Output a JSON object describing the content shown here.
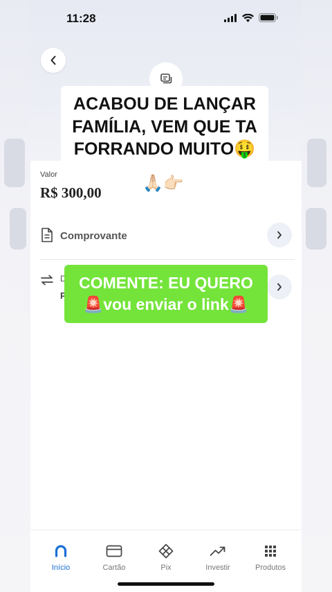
{
  "status_bar": {
    "time": "11:28"
  },
  "header": {
    "back_icon": "chevron-left-icon",
    "receipt_icon": "receipt-icon"
  },
  "overlay_top": {
    "line1": "ACABOU DE LANÇAR",
    "line2": "FAMÍLIA, VEM QUE TA",
    "line3": "FORRANDO MUITO🤑"
  },
  "transaction": {
    "valor_label": "Valor",
    "valor_amount": "R$ 300,00",
    "emoji": "🙏🏻👉🏻"
  },
  "rows": {
    "comprovante_label": "Comprovante",
    "partial_label": "D",
    "partial_bold": "P"
  },
  "overlay_bottom": {
    "line1": "COMENTE: EU QUERO",
    "line2": "🚨vou enviar o link🚨"
  },
  "tabbar": {
    "items": [
      {
        "label": "Início",
        "icon": "home-icon",
        "active": true
      },
      {
        "label": "Cartão",
        "icon": "card-icon"
      },
      {
        "label": "Pix",
        "icon": "pix-icon"
      },
      {
        "label": "Investir",
        "icon": "trend-up-icon"
      },
      {
        "label": "Produtos",
        "icon": "grid-icon"
      }
    ]
  },
  "colors": {
    "accent": "#1a6fd6",
    "green_banner": "#74e43a"
  }
}
